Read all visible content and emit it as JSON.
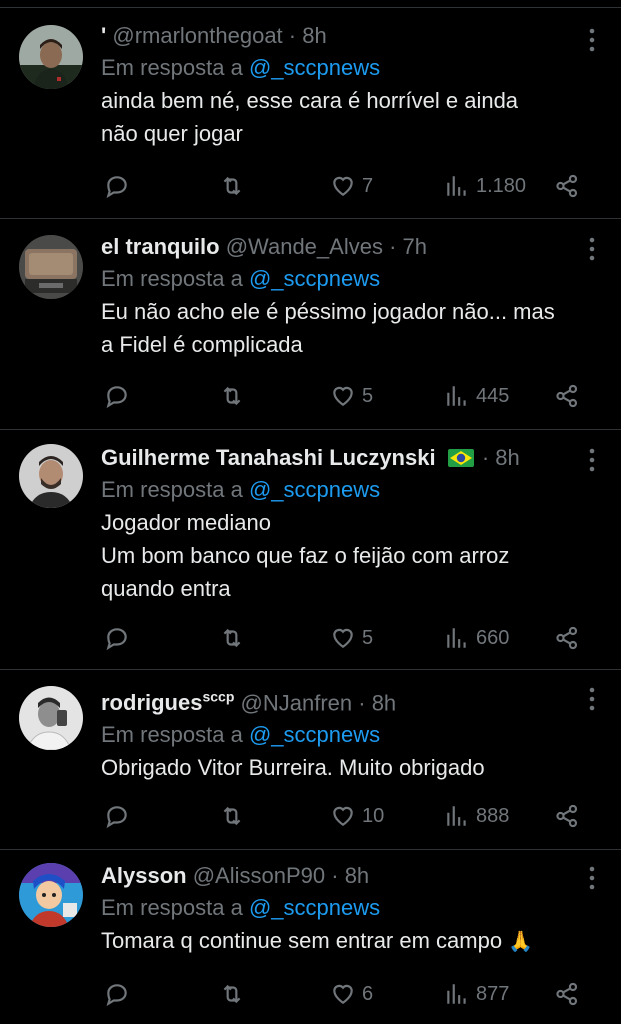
{
  "replies": [
    {
      "name": "'",
      "handle": "@rmarlonthegoat",
      "time": "8h",
      "reply_prefix": "Em resposta a",
      "reply_to": "@_sccpnews",
      "text_lines": [
        "ainda bem né, esse cara é horrível e ainda",
        "não quer jogar"
      ],
      "likes": "7",
      "views": "1.180",
      "avatar_bg": "#2b3a2b"
    },
    {
      "name": "el tranquilo",
      "handle": "@Wande_Alves",
      "time": "7h",
      "reply_prefix": "Em resposta a",
      "reply_to": "@_sccpnews",
      "text_lines": [
        "Eu não acho ele é péssimo jogador não... mas",
        "a Fidel é complicada"
      ],
      "likes": "5",
      "views": "445",
      "avatar_bg": "#6b5a4a"
    },
    {
      "name": "Guilherme Tanahashi Luczynski",
      "flag": "brazil-flag-icon",
      "handle": "",
      "time": "8h",
      "reply_prefix": "Em resposta a",
      "reply_to": "@_sccpnews",
      "text_lines": [
        "Jogador mediano",
        "Um bom banco que faz o feijão com arroz",
        "quando entra"
      ],
      "likes": "5",
      "views": "660",
      "avatar_bg": "#3a3a3a"
    },
    {
      "name": "rodrigues",
      "name_sup": "sccp",
      "handle": "@NJanfren",
      "time": "8h",
      "reply_prefix": "Em resposta a",
      "reply_to": "@_sccpnews",
      "text_lines": [
        "Obrigado Vitor Burreira. Muito obrigado"
      ],
      "likes": "10",
      "views": "888",
      "avatar_bg": "#555555"
    },
    {
      "name": "Alysson",
      "handle": "@AlissonP90",
      "time": "8h",
      "reply_prefix": "Em resposta a",
      "reply_to": "@_sccpnews",
      "text_lines": [
        "Tomara q continue sem entrar em campo"
      ],
      "text_emoji": "🙏",
      "likes": "6",
      "views": "877",
      "avatar_bg": "#3a9ad9"
    }
  ],
  "colors": {
    "background": "#000000",
    "text": "#e7e9ea",
    "muted": "#71767b",
    "link": "#1d9bf0",
    "divider": "#2f3336"
  }
}
